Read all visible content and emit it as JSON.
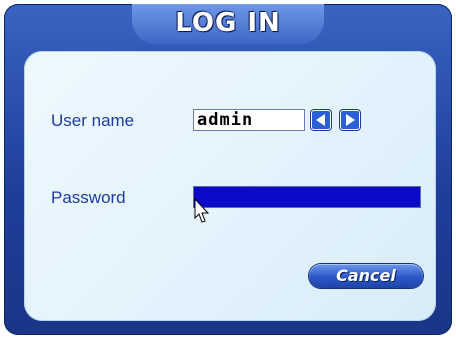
{
  "dialog": {
    "title": "LOG IN",
    "username_label": "User name",
    "username_value": "admin",
    "password_label": "Password",
    "password_value": "",
    "cancel_label": "Cancel"
  },
  "icons": {
    "prev": "left-arrow-icon",
    "next": "right-arrow-icon",
    "cursor": "mouse-pointer-icon"
  },
  "colors": {
    "frame": "#1f3f9c",
    "panel": "#e2f2fc",
    "label": "#1e3c9a",
    "password_field": "#0a0ac8",
    "button": "#2b57c6"
  }
}
